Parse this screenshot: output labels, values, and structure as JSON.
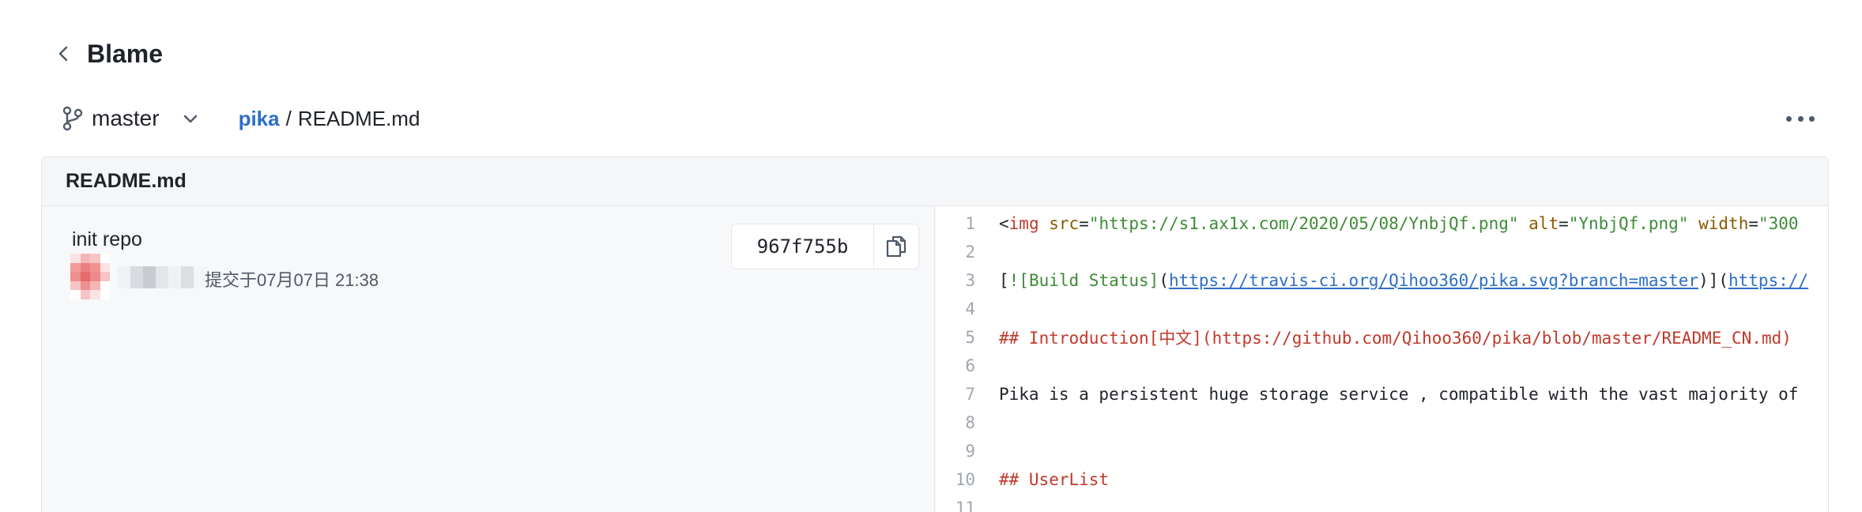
{
  "header": {
    "title": "Blame"
  },
  "toolbar": {
    "branch": "master",
    "breadcrumb": {
      "repo": "pika",
      "separator": "/",
      "file": "README.md"
    }
  },
  "panel": {
    "filename": "README.md",
    "commit": {
      "message": "init repo",
      "meta": "提交于07月07日 21:38",
      "sha": "967f755b"
    }
  },
  "code_lines": [
    {
      "n": "1",
      "tokens": [
        {
          "t": "<",
          "c": "code"
        },
        {
          "t": "img",
          "c": "tag"
        },
        {
          "t": " ",
          "c": "code"
        },
        {
          "t": "src",
          "c": "attr"
        },
        {
          "t": "=",
          "c": "code"
        },
        {
          "t": "\"https://s1.ax1x.com/2020/05/08/YnbjQf.png\"",
          "c": "str"
        },
        {
          "t": " ",
          "c": "code"
        },
        {
          "t": "alt",
          "c": "attr"
        },
        {
          "t": "=",
          "c": "code"
        },
        {
          "t": "\"YnbjQf.png\"",
          "c": "str"
        },
        {
          "t": "  ",
          "c": "code"
        },
        {
          "t": "width",
          "c": "attr"
        },
        {
          "t": "=",
          "c": "code"
        },
        {
          "t": "\"300",
          "c": "str"
        }
      ]
    },
    {
      "n": "2",
      "tokens": []
    },
    {
      "n": "3",
      "tokens": [
        {
          "t": "[",
          "c": "code"
        },
        {
          "t": "![Build Status]",
          "c": "linktext"
        },
        {
          "t": "(",
          "c": "code"
        },
        {
          "t": "https://travis-ci.org/Qihoo360/pika.svg?branch=master",
          "c": "url"
        },
        {
          "t": ")](",
          "c": "code"
        },
        {
          "t": "https://",
          "c": "url"
        }
      ]
    },
    {
      "n": "4",
      "tokens": []
    },
    {
      "n": "5",
      "tokens": [
        {
          "t": "## Introduction[中文](https://github.com/Qihoo360/pika/blob/master/README_CN.md)",
          "c": "heading"
        }
      ]
    },
    {
      "n": "6",
      "tokens": []
    },
    {
      "n": "7",
      "tokens": [
        {
          "t": "Pika is a persistent huge storage service , compatible  with the vast majority of",
          "c": "code"
        }
      ]
    },
    {
      "n": "8",
      "tokens": []
    },
    {
      "n": "9",
      "tokens": []
    },
    {
      "n": "10",
      "tokens": [
        {
          "t": "## UserList",
          "c": "heading"
        }
      ]
    },
    {
      "n": "11",
      "tokens": []
    }
  ],
  "colors": {
    "accent": "#2d6ec6",
    "tag": "#c0392b",
    "attr": "#8a5a00",
    "string": "#3d8b37"
  },
  "icons": [
    "chevron-left-icon",
    "branch-icon",
    "chevron-down-icon",
    "more-icon",
    "copy-icon"
  ]
}
